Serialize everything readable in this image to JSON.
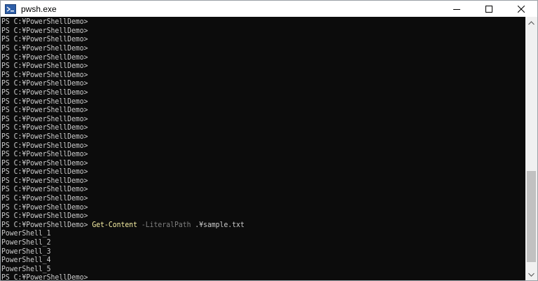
{
  "window": {
    "title": "pwsh.exe",
    "icons": {
      "app": "powershell-app-icon",
      "minimize": "minimize-icon",
      "maximize": "maximize-icon",
      "close": "close-icon"
    }
  },
  "console": {
    "prompt": "PS C:¥PowerShellDemo>",
    "empty_prompt_count": 24,
    "command": {
      "name": "Get-Content",
      "parameter": "-LiteralPath",
      "argument": ".¥sample.txt"
    },
    "output_lines": [
      "PowerShell_1",
      "PowerShell_2",
      "PowerShell_3",
      "PowerShell_4",
      "PowerShell_5"
    ]
  },
  "scrollbar": {
    "up_icon": "scroll-up-arrow-icon",
    "down_icon": "scroll-down-arrow-icon"
  },
  "colors": {
    "console_background": "#0c0c0c",
    "console_text": "#cccccc",
    "command_name": "#f9f1a5",
    "command_parameter": "#808080"
  }
}
